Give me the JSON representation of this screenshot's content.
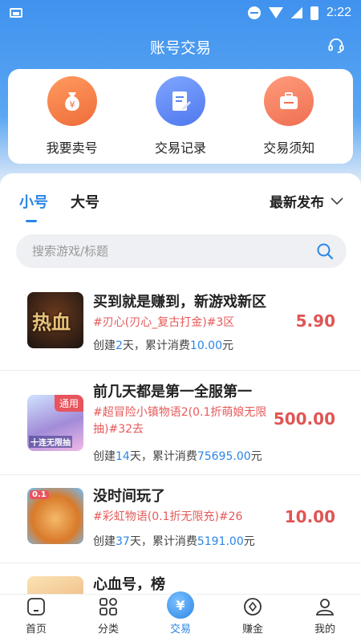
{
  "status": {
    "time": "2:22"
  },
  "header": {
    "title": "账号交易",
    "service_icon": "headset-icon"
  },
  "quick_actions": [
    {
      "label": "我要卖号",
      "icon": "money-bag-icon",
      "color": "#f27d4a"
    },
    {
      "label": "交易记录",
      "icon": "document-edit-icon",
      "color": "#5b86f0"
    },
    {
      "label": "交易须知",
      "icon": "briefcase-icon",
      "color": "#f07a5a"
    }
  ],
  "tabs": [
    {
      "label": "小号",
      "active": true
    },
    {
      "label": "大号",
      "active": false
    }
  ],
  "sort": {
    "label": "最新发布"
  },
  "search": {
    "placeholder": "搜索游戏/标题"
  },
  "listings": [
    {
      "title": "买到就是赚到，新游戏新区",
      "tag": "#刃心(刃心_复古打金)#3区",
      "created_prefix": "创建",
      "days": "2",
      "created_suffix": "天，累计消费",
      "spent": "10.00",
      "spent_suffix": "元",
      "price": "5.90",
      "badge": "",
      "thumb_text": "热血"
    },
    {
      "title": "前几天都是第一全服第一",
      "tag": "#超冒险小镇物语2(0.1折萌娘无限抽)#32去",
      "created_prefix": "创建",
      "days": "14",
      "created_suffix": "天，累计消费",
      "spent": "75695.00",
      "spent_suffix": "元",
      "price": "500.00",
      "badge": "通用",
      "thumb_text": "十连无限抽"
    },
    {
      "title": "没时间玩了",
      "tag": "#彩虹物语(0.1折无限充)#26",
      "created_prefix": "创建",
      "days": "37",
      "created_suffix": "天，累计消费",
      "spent": "5191.00",
      "spent_suffix": "元",
      "price": "10.00",
      "badge": "",
      "thumb_text": "0.1"
    },
    {
      "title": "心血号，榜",
      "tag": "",
      "created_prefix": "",
      "days": "",
      "created_suffix": "",
      "spent": "",
      "spent_suffix": "",
      "price": "",
      "badge": "",
      "thumb_text": ""
    }
  ],
  "tabbar": [
    {
      "label": "首页",
      "icon": "home-icon",
      "active": false
    },
    {
      "label": "分类",
      "icon": "grid-icon",
      "active": false
    },
    {
      "label": "交易",
      "icon": "trade-icon",
      "active": true
    },
    {
      "label": "赚金",
      "icon": "coin-icon",
      "active": false
    },
    {
      "label": "我的",
      "icon": "profile-icon",
      "active": false
    }
  ]
}
